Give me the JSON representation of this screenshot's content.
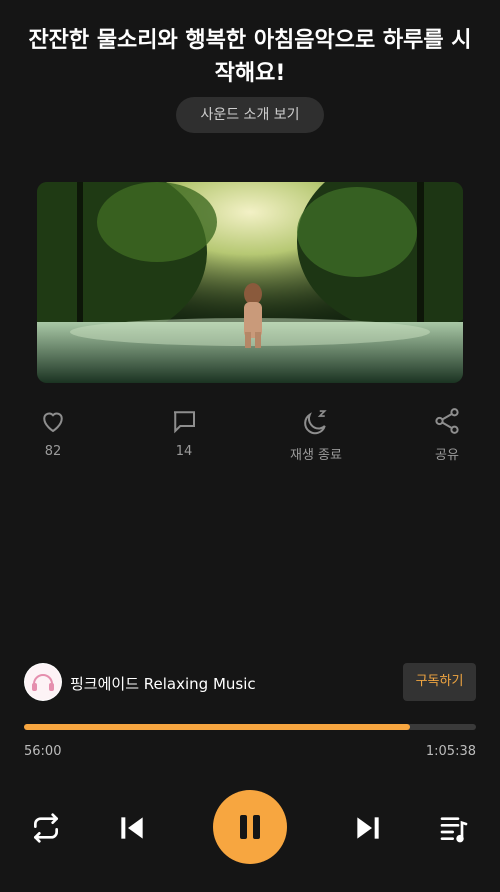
{
  "header": {
    "title": "잔잔한 물소리와 행복한 아침음악으로 하루를 시작해요!",
    "intro_button_label": "사운드 소개 보기"
  },
  "actions": [
    {
      "icon": "heart-icon",
      "label": "82"
    },
    {
      "icon": "comment-icon",
      "label": "14"
    },
    {
      "icon": "sleep-timer-icon",
      "label": "재생 종료"
    },
    {
      "icon": "share-icon",
      "label": "공유"
    }
  ],
  "channel": {
    "name": "핑크에이드 Relaxing Music",
    "subscribe_label": "구독하기"
  },
  "player": {
    "elapsed": "56:00",
    "duration": "1:05:38",
    "progress_fraction": 0.853
  },
  "colors": {
    "accent": "#f7a640",
    "background": "#151515"
  }
}
